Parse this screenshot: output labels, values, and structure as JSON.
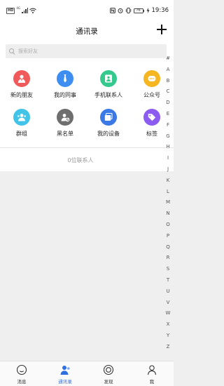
{
  "status_bar": {
    "network_badge": "HD",
    "signal_label": "4G",
    "battery_level": "76",
    "time": "19:36"
  },
  "header": {
    "title": "通讯录"
  },
  "search": {
    "placeholder": "搜索好友"
  },
  "grid": {
    "items": [
      {
        "label": "新的朋友",
        "icon": "new-friend-icon",
        "color": "#f05a5a"
      },
      {
        "label": "我的同事",
        "icon": "colleague-icon",
        "color": "#3d8ef0"
      },
      {
        "label": "手机联系人",
        "icon": "phone-contacts-icon",
        "color": "#35c98e"
      },
      {
        "label": "公众号",
        "icon": "public-account-icon",
        "color": "#f5b621"
      },
      {
        "label": "群组",
        "icon": "group-icon",
        "color": "#41c4e8"
      },
      {
        "label": "黑名单",
        "icon": "blacklist-icon",
        "color": "#6e6e6e"
      },
      {
        "label": "我的设备",
        "icon": "devices-icon",
        "color": "#3b79e6"
      },
      {
        "label": "标签",
        "icon": "tag-icon",
        "color": "#8c5cf0"
      }
    ]
  },
  "contact_count": "0位联系人",
  "alpha_index": [
    "#",
    "A",
    "B",
    "C",
    "D",
    "E",
    "F",
    "G",
    "H",
    "I",
    "J",
    "K",
    "L",
    "M",
    "N",
    "O",
    "P",
    "Q",
    "R",
    "S",
    "T",
    "U",
    "V",
    "W",
    "X",
    "Y",
    "Z"
  ],
  "tab_bar": {
    "tabs": [
      {
        "label": "消息",
        "icon": "message-icon"
      },
      {
        "label": "通讯录",
        "icon": "contacts-icon",
        "active": true
      },
      {
        "label": "发现",
        "icon": "discover-icon"
      },
      {
        "label": "我",
        "icon": "profile-icon"
      }
    ]
  },
  "colors": {
    "accent": "#2f6fe0",
    "background": "#efefef"
  }
}
